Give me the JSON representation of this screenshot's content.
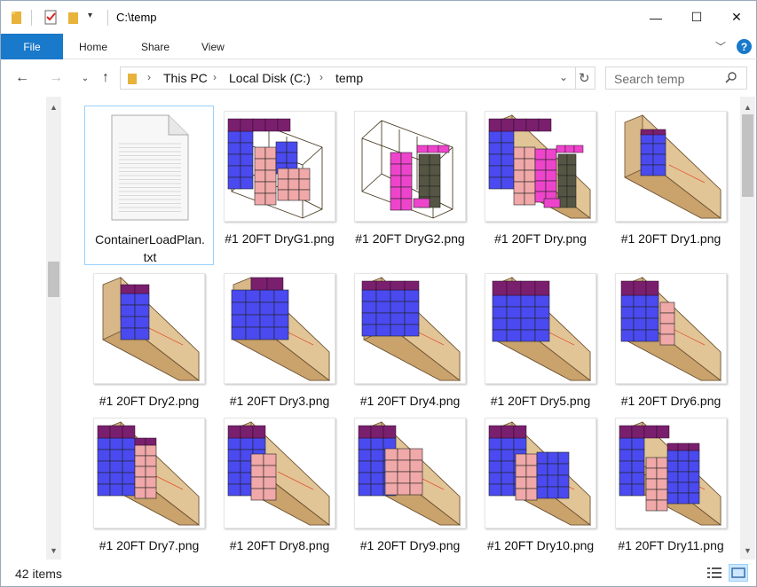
{
  "window": {
    "title": "C:\\temp",
    "minimize": "—",
    "maximize": "☐",
    "close": "✕"
  },
  "ribbon": {
    "file": "File",
    "tabs": [
      "Home",
      "Share",
      "View"
    ]
  },
  "address": {
    "crumbs": [
      "This PC",
      "Local Disk (C:)",
      "temp"
    ],
    "search_placeholder": "Search temp"
  },
  "files": [
    {
      "name": "ContainerLoadPlan.txt",
      "line1": "ContainerLoadPlan.",
      "line2": "txt",
      "kind": "txt",
      "selected": true
    },
    {
      "name": "#1 20FT DryG1.png",
      "kind": "png",
      "variant": "g1"
    },
    {
      "name": "#1 20FT DryG2.png",
      "kind": "png",
      "variant": "g2"
    },
    {
      "name": "#1 20FT Dry.png",
      "kind": "png",
      "variant": "full"
    },
    {
      "name": "#1 20FT Dry1.png",
      "kind": "png",
      "variant": "s1"
    },
    {
      "name": "#1 20FT Dry2.png",
      "kind": "png",
      "variant": "s2"
    },
    {
      "name": "#1 20FT Dry3.png",
      "kind": "png",
      "variant": "s3"
    },
    {
      "name": "#1 20FT Dry4.png",
      "kind": "png",
      "variant": "s4"
    },
    {
      "name": "#1 20FT Dry5.png",
      "kind": "png",
      "variant": "s5"
    },
    {
      "name": "#1 20FT Dry6.png",
      "kind": "png",
      "variant": "s6"
    },
    {
      "name": "#1 20FT Dry7.png",
      "kind": "png",
      "variant": "s7"
    },
    {
      "name": "#1 20FT Dry8.png",
      "kind": "png",
      "variant": "s8"
    },
    {
      "name": "#1 20FT Dry9.png",
      "kind": "png",
      "variant": "s9"
    },
    {
      "name": "#1 20FT Dry10.png",
      "kind": "png",
      "variant": "s10"
    },
    {
      "name": "#1 20FT Dry11.png",
      "kind": "png",
      "variant": "s11"
    }
  ],
  "status": {
    "count": "42 items"
  },
  "colors": {
    "file_tab": "#1979ca",
    "blue_box": "#4a4af0",
    "purple_top": "#7a1f6e",
    "pink_box": "#f0a8a8",
    "magenta_box": "#ee44cc",
    "olive_box": "#555544",
    "container": "#d8b888"
  }
}
